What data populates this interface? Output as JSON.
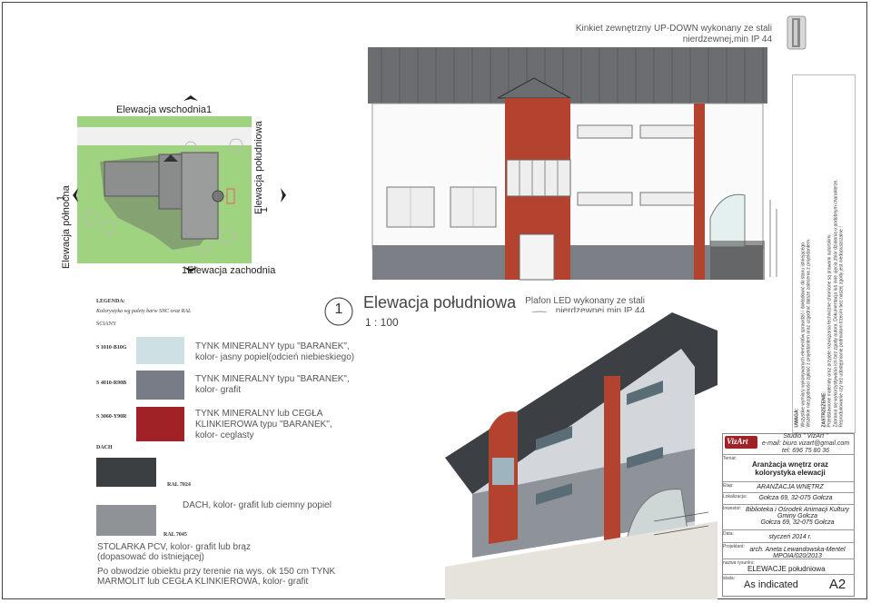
{
  "lamp_top": {
    "line1": "Kinkiet zewnętrzny UP-DOWN wykonany ze stali",
    "line2": "nierdzewnej,min IP 44"
  },
  "lamp_mid": {
    "line1": "Plafon LED wykonany ze stali",
    "line2": "nierdzewnej,min IP 44"
  },
  "site_plan": {
    "label_east": "Elewacja wschodnia1",
    "label_south": "Elewacja południowa",
    "label_south_num": "1",
    "label_north": "Elewacja północna",
    "label_north_num": "1",
    "label_west": "1Elewacja zachodnia"
  },
  "legend": {
    "title": "LEGENDA:",
    "subtitle": "Kolorystyka wg palety barw  SNC oraz RAL",
    "section_walls": "ŚCIANY",
    "items": [
      {
        "code": "S 1010-B10G",
        "desc1": "TYNK MINERALNY typu \"BARANEK\",",
        "desc2": "kolor- jasny popiel(odcień niebieskiego)",
        "desc3": "",
        "color": "#cfe0e4"
      },
      {
        "code": "S 4010-R90B",
        "desc1": "TYNK MINERALNY typu \"BARANEK\",",
        "desc2": "kolor- grafit",
        "desc3": "",
        "color": "#777c87"
      },
      {
        "code": "S 3060-Y90R",
        "desc1": "TYNK MINERALNY lub CEGŁA",
        "desc2": "KLINKIEROWA typu \"BARANEK\",",
        "desc3": "kolor- ceglasty",
        "color": "#a02227"
      }
    ],
    "section_roof": "DACH",
    "roof": {
      "code": "RAL 7024",
      "color": "#3b3f42"
    },
    "roof_desc": "DACH, kolor- grafit lub ciemny popiel",
    "window": {
      "code": "RAL 7045",
      "color": "#8f9297"
    },
    "window_desc1": "STOLARKA PCV, kolor- grafit lub brąz",
    "window_desc2": "(dopasować do istniejącej)",
    "note1": "Po obwodzie obiektu przy terenie na wys. ok 150 cm TYNK",
    "note2": "MARMOLIT lub CEGŁA KLINKIEROWA, kolor- grafit"
  },
  "elevation": {
    "number": "1",
    "title": "Elewacja południowa",
    "scale": "1 : 100"
  },
  "side_note": {
    "heading1": "UWAGA:",
    "text1a": "Wszystkie wymiary wykonywanych elementów sprawdzić i dokładowić do stanu istniejącego.",
    "text1b": "Wszelkie niezgodności zgłosić z projektantem oraz uzgodnić dalsze zalecenia z projektantem.",
    "heading2": "ZASTRZEŻENIE:",
    "text2a": "Przedstawione materiały oraz przyjęte rozwiązania techniczne chronione są prawami autorskimi.",
    "text2b": "Zabrania się wykorzystywania ich bez zgody autora. Dokumentacja lub inne ujęcia zbiór działania o podobnym charakterze.",
    "text2c": "Reprodukowanie czy też udostępnianie podmiotom trzecim bez naszej zgody jest niedopuszczalne !"
  },
  "title_block": {
    "logo": "VizArt",
    "studio": "Studio \" VizArt \"",
    "email": "e-mail: biuro.vizart@gmail.com",
    "phone": "tel: 696 75 80 36",
    "temat_label": "Temat:",
    "temat": "Aranżacja wnętrz oraz kolorystyka elewacji",
    "etap_label": "Etap:",
    "etap": "ARANŻACJA WNĘTRZ",
    "lok_label": "Lokalizacja:",
    "lok": "Gołcza 69, 32-075 Gołcza",
    "inw_label": "Inwestor:",
    "inw1": "Biblioteka i Ośrodek Animacji Kultury",
    "inw2": "Gminy Gołcza",
    "inw3": "Gołcza 69, 32-075 Gołcza",
    "data_label": "Data:",
    "data": "styczeń 2014 r.",
    "proj_label": "Projektant:",
    "proj1": "arch. Aneta Lewandowska-Mentel",
    "proj2": "MPOIA/020/2013",
    "rys_label": "nazwa rysunku:",
    "rys": "ELEWACJE południowa",
    "skala_label": "skala:",
    "skala": "As indicated",
    "sheet": "A2"
  }
}
